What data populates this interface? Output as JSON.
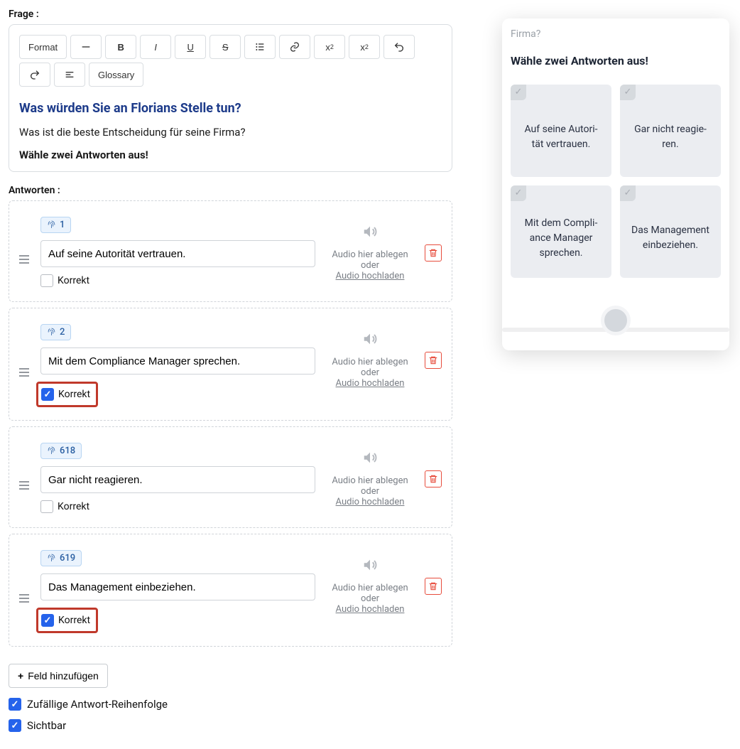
{
  "labels": {
    "question": "Frage :",
    "answers": "Antworten :"
  },
  "toolbar": {
    "format": "Format",
    "glossary": "Glossary"
  },
  "question": {
    "heading": "Was würden Sie an Florians Stelle tun?",
    "body": "Was ist die beste Entscheidung für seine Firma?",
    "instruction": "Wähle zwei Antworten aus!"
  },
  "audio": {
    "drop_text": "Audio hier ablegen oder",
    "upload_link": "Audio hochladen"
  },
  "correct_label": "Korrekt",
  "answers": [
    {
      "tag": "1",
      "text": "Auf seine Autorität vertrauen.",
      "correct": false,
      "highlight": false
    },
    {
      "tag": "2",
      "text": "Mit dem Compliance Manager sprechen.",
      "correct": true,
      "highlight": true
    },
    {
      "tag": "618",
      "text": "Gar nicht reagieren.",
      "correct": false,
      "highlight": false
    },
    {
      "tag": "619",
      "text": "Das Management einbeziehen.",
      "correct": true,
      "highlight": true
    }
  ],
  "add_field": "Feld hinzufügen",
  "options": {
    "random": {
      "label": "Zufällige Antwort-Reihenfolge",
      "checked": true
    },
    "visible": {
      "label": "Sichtbar",
      "checked": true
    }
  },
  "preview": {
    "firma": "Firma?",
    "title": "Wähle zwei Antworten aus!",
    "cards": [
      "Auf seine Au­to­ri­tät ver­trau­en.",
      "Gar nicht re­agie­ren.",
      "Mit dem Com­pli­ance Ma­na­ger spre­chen.",
      "Das Ma­nage­ment ein­be­zie­hen."
    ]
  }
}
